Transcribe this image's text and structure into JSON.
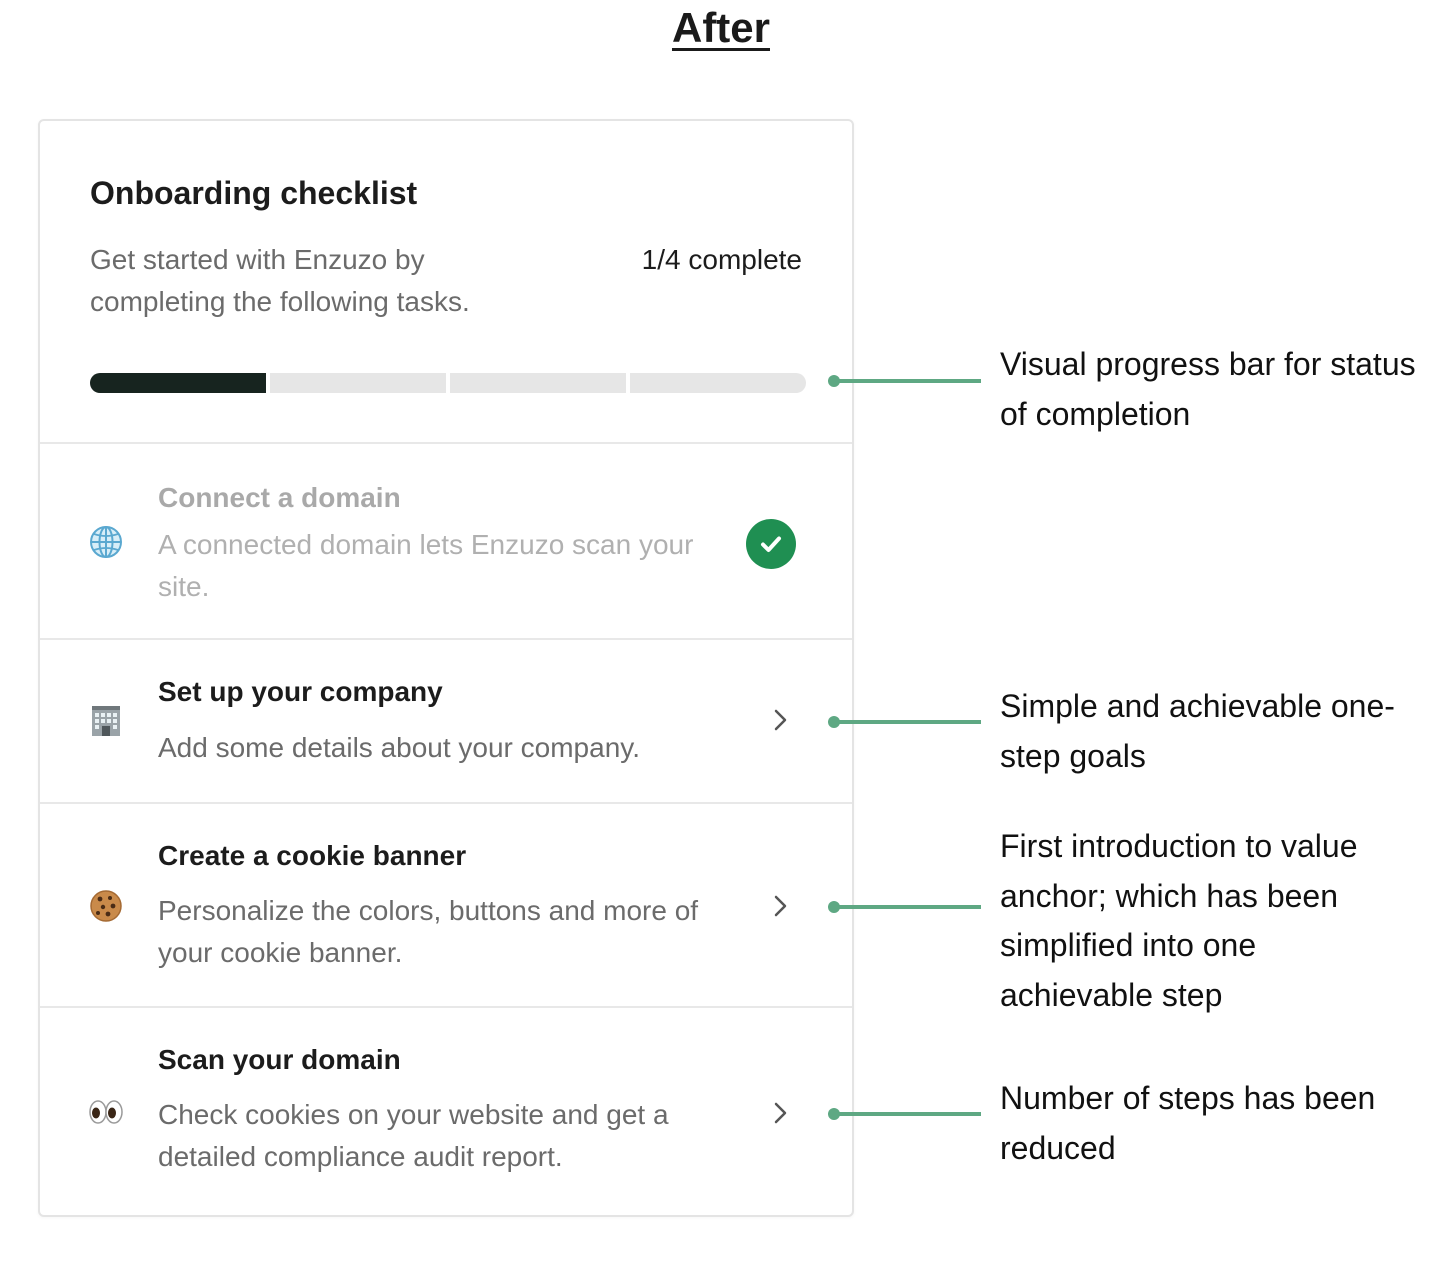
{
  "page": {
    "heading": "After"
  },
  "checklist": {
    "title": "Onboarding checklist",
    "subtitle": "Get started with Enzuzo by completing the following tasks.",
    "progress_label": "1/4 complete",
    "progress": {
      "completed": 1,
      "total": 4
    },
    "tasks": [
      {
        "icon": "globe-icon",
        "title": "Connect a domain",
        "description": "A connected domain lets Enzuzo scan your site.",
        "status": "complete",
        "action_icon": "check-circle-icon"
      },
      {
        "icon": "office-building-icon",
        "title": "Set up your company",
        "description": "Add some details about your company.",
        "status": "pending",
        "action_icon": "chevron-right-icon"
      },
      {
        "icon": "cookie-icon",
        "title": "Create a cookie banner",
        "description": "Personalize the colors, buttons and more of your cookie banner.",
        "status": "pending",
        "action_icon": "chevron-right-icon"
      },
      {
        "icon": "eyes-icon",
        "title": "Scan your domain",
        "description": "Check cookies on your website and get a detailed compliance audit report.",
        "status": "pending",
        "action_icon": "chevron-right-icon"
      }
    ]
  },
  "annotations": [
    {
      "text": "Visual progress bar for status of completion"
    },
    {
      "text": "Simple and achievable one-step goals"
    },
    {
      "text": "First introduction to value anchor; which has been simplified into one achievable step"
    },
    {
      "text": "Number of steps has been reduced"
    }
  ],
  "colors": {
    "progress_filled": "#17241f",
    "progress_empty": "#e6e6e6",
    "check_badge": "#1f8f52",
    "annotation_line": "#5ea883"
  }
}
